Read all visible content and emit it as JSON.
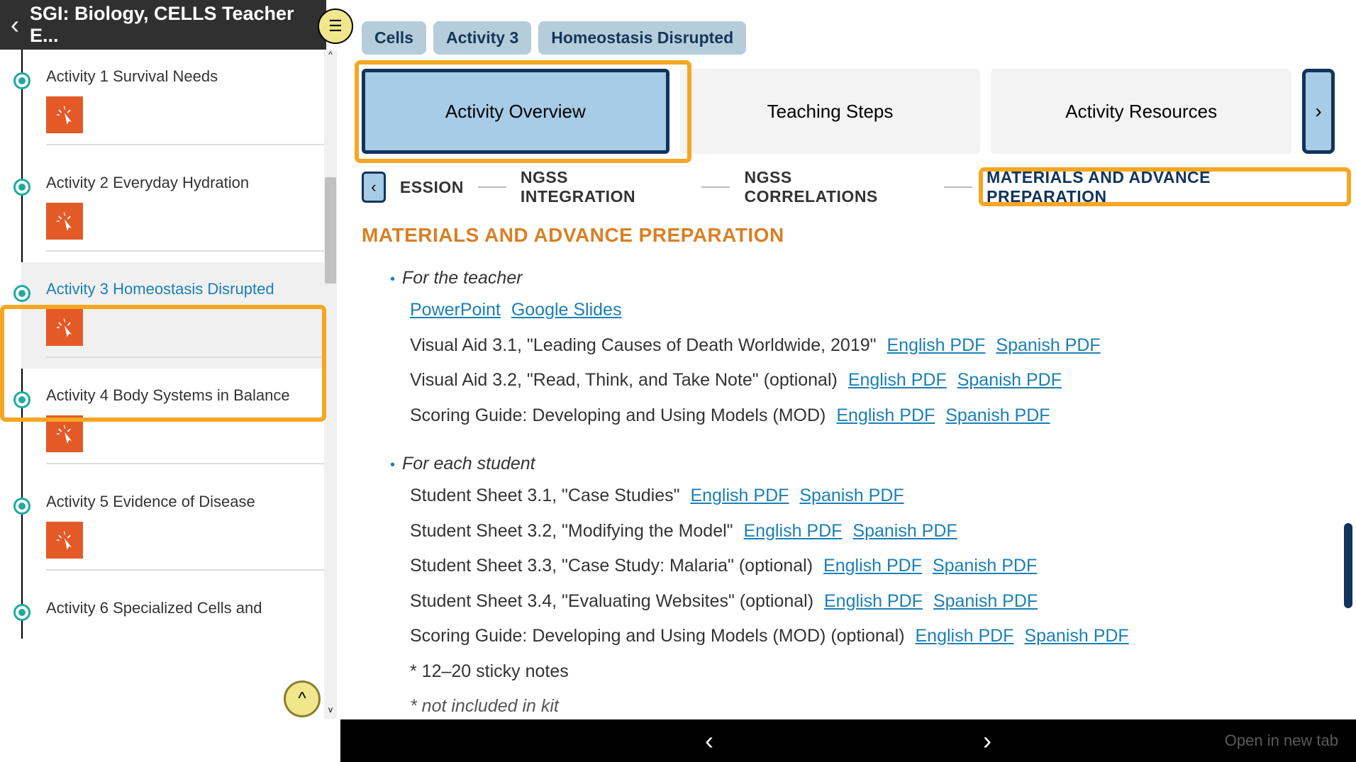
{
  "header": {
    "title": "SGI: Biology, CELLS Teacher E..."
  },
  "sidebar": {
    "items": [
      {
        "title": "Activity 1 Survival Needs"
      },
      {
        "title": "Activity 2 Everyday Hydration"
      },
      {
        "title": "Activity 3 Homeostasis Disrupted"
      },
      {
        "title": "Activity 4 Body Systems in Balance"
      },
      {
        "title": "Activity 5 Evidence of Disease"
      },
      {
        "title": "Activity 6 Specialized Cells and"
      }
    ]
  },
  "breadcrumbs": {
    "a": "Cells",
    "b": "Activity 3",
    "c": "Homeostasis Disrupted"
  },
  "mainTabs": {
    "overview": "Activity Overview",
    "steps": "Teaching Steps",
    "resources": "Activity Resources"
  },
  "subnav": {
    "partial": "ESSION",
    "b": "NGSS INTEGRATION",
    "c": "NGSS CORRELATIONS",
    "d": "MATERIALS AND ADVANCE PREPARATION"
  },
  "section": {
    "heading": "MATERIALS AND ADVANCE PREPARATION"
  },
  "materials": {
    "teacher": {
      "label": "For the teacher",
      "ppt": "PowerPoint",
      "gslides": "Google Slides",
      "va31": "Visual Aid 3.1, \"Leading Causes of Death Worldwide, 2019\"",
      "va32": "Visual Aid 3.2, \"Read, Think, and Take Note\" (optional)",
      "sg": "Scoring Guide: Developing and Using Models (MOD)",
      "en": "English PDF",
      "es": "Spanish PDF"
    },
    "student": {
      "label": "For each student",
      "ss31": "Student Sheet 3.1, \"Case Studies\"",
      "ss32": "Student Sheet 3.2, \"Modifying the Model\"",
      "ss33": "Student Sheet 3.3, \"Case Study: Malaria\" (optional)",
      "ss34": "Student Sheet 3.4, \"Evaluating Websites\" (optional)",
      "sg": "Scoring Guide: Developing and Using Models (MOD) (optional)",
      "sticky": "* 12–20 sticky notes",
      "notinkit": "* not included in kit",
      "en": "English PDF",
      "es": "Spanish PDF"
    }
  },
  "bottom": {
    "openTab": "Open in new tab"
  }
}
